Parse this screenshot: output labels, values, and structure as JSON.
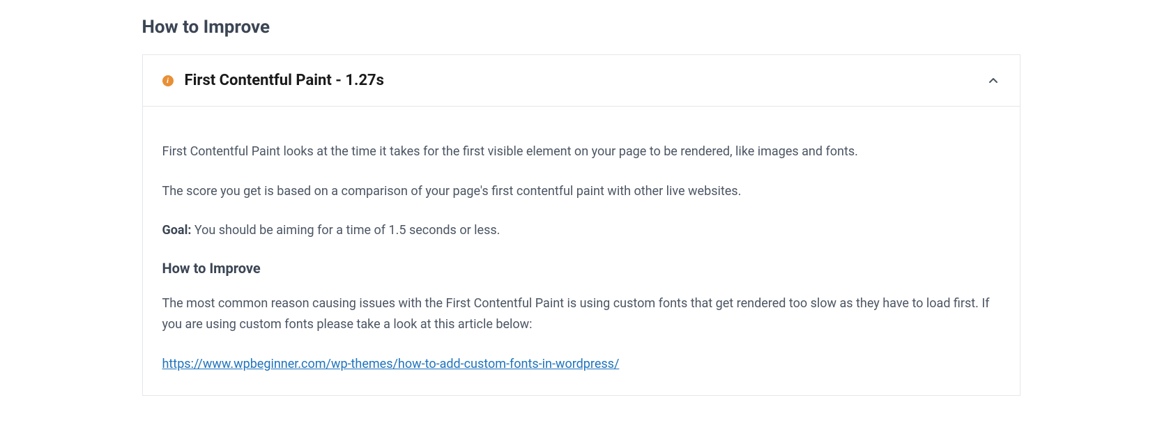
{
  "page": {
    "title": "How to Improve"
  },
  "accordion": {
    "icon_name": "info-icon",
    "title": "First Contentful Paint - 1.27s",
    "content": {
      "paragraph1": "First Contentful Paint looks at the time it takes for the first visible element on your page to be rendered, like images and fonts.",
      "paragraph2": "The score you get is based on a comparison of your page's first contentful paint with other live websites.",
      "goal_label": "Goal:",
      "goal_text": " You should be aiming for a time of 1.5 seconds or less.",
      "sub_heading": "How to Improve",
      "paragraph3": "The most common reason causing issues with the First Contentful Paint is using custom fonts that get rendered too slow as they have to load first. If you are using custom fonts please take a look at this article below:",
      "link_text": "https://www.wpbeginner.com/wp-themes/how-to-add-custom-fonts-in-wordpress/"
    }
  }
}
